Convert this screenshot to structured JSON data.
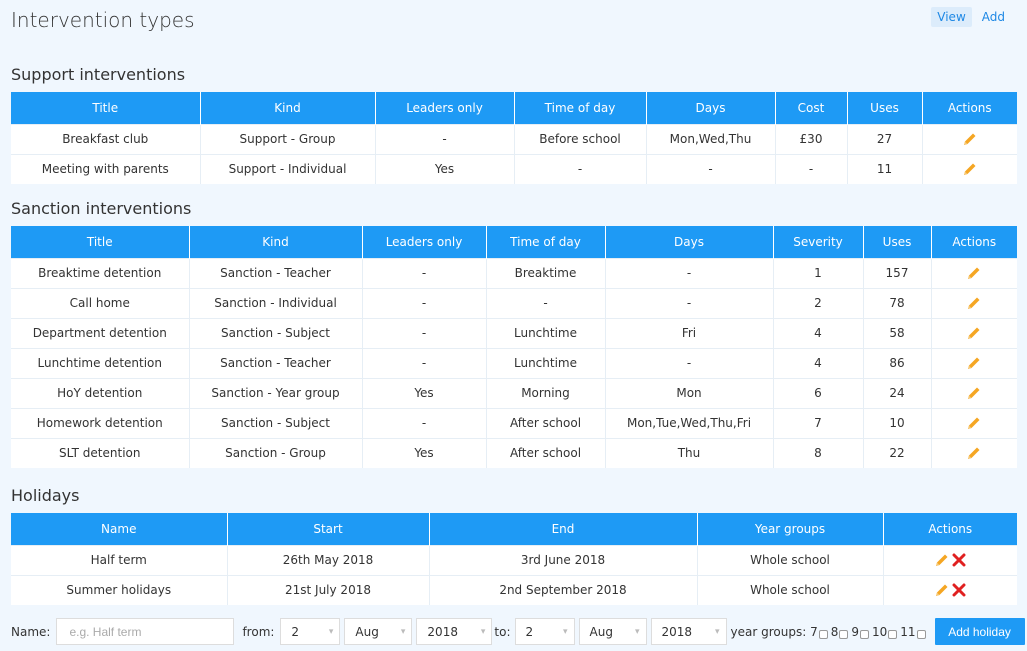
{
  "page": {
    "title": "Intervention types"
  },
  "top_actions": {
    "view": "View",
    "add": "Add"
  },
  "support": {
    "title": "Support interventions",
    "headers": [
      "Title",
      "Kind",
      "Leaders only",
      "Time of day",
      "Days",
      "Cost",
      "Uses",
      "Actions"
    ],
    "rows": [
      [
        "Breakfast club",
        "Support - Group",
        "-",
        "Before school",
        "Mon,Wed,Thu",
        "£30",
        "27"
      ],
      [
        "Meeting with parents",
        "Support - Individual",
        "Yes",
        "-",
        "-",
        "-",
        "11"
      ]
    ]
  },
  "sanction": {
    "title": "Sanction interventions",
    "headers": [
      "Title",
      "Kind",
      "Leaders only",
      "Time of day",
      "Days",
      "Severity",
      "Uses",
      "Actions"
    ],
    "rows": [
      [
        "Breaktime detention",
        "Sanction - Teacher",
        "-",
        "Breaktime",
        "-",
        "1",
        "157"
      ],
      [
        "Call home",
        "Sanction - Individual",
        "-",
        "-",
        "-",
        "2",
        "78"
      ],
      [
        "Department detention",
        "Sanction - Subject",
        "-",
        "Lunchtime",
        "Fri",
        "4",
        "58"
      ],
      [
        "Lunchtime detention",
        "Sanction - Teacher",
        "-",
        "Lunchtime",
        "-",
        "4",
        "86"
      ],
      [
        "HoY detention",
        "Sanction - Year group",
        "Yes",
        "Morning",
        "Mon",
        "6",
        "24"
      ],
      [
        "Homework detention",
        "Sanction - Subject",
        "-",
        "After school",
        "Mon,Tue,Wed,Thu,Fri",
        "7",
        "10"
      ],
      [
        "SLT detention",
        "Sanction - Group",
        "Yes",
        "After school",
        "Thu",
        "8",
        "22"
      ]
    ]
  },
  "holidays": {
    "title": "Holidays",
    "headers": [
      "Name",
      "Start",
      "End",
      "Year groups",
      "Actions"
    ],
    "rows": [
      [
        "Half term",
        "26th May 2018",
        "3rd June 2018",
        "Whole school"
      ],
      [
        "Summer holidays",
        "21st July 2018",
        "2nd September 2018",
        "Whole school"
      ]
    ]
  },
  "form": {
    "name_label": "Name:",
    "name_placeholder": "e.g. Half term",
    "from_label": "from:",
    "from_day": "2",
    "from_month": "Aug",
    "from_year": "2018",
    "to_label": "to:",
    "to_day": "2",
    "to_month": "Aug",
    "to_year": "2018",
    "year_groups_label": "year groups: 7",
    "year_groups": [
      "8",
      "9",
      "10",
      "11"
    ],
    "add_button": "Add holiday"
  },
  "colors": {
    "accent": "#1e9af5",
    "edit": "#f5a623",
    "delete": "#e02020"
  },
  "icons": {
    "edit": "pencil-icon",
    "delete": "cross-icon",
    "dropdown": "chevron-down-icon"
  }
}
